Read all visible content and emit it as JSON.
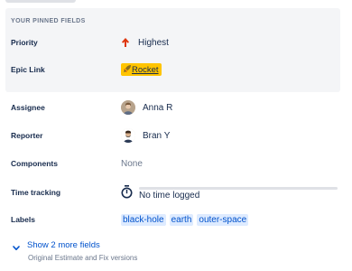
{
  "pinned": {
    "heading": "YOUR PINNED FIELDS",
    "fields": [
      {
        "label": "Priority",
        "value": "Highest",
        "icon": "arrow-up-icon",
        "icon_color": "#de350b"
      },
      {
        "label": "Epic Link",
        "value": "Rocket",
        "icon": "rocket-icon",
        "lozenge_color": "#ffc400"
      }
    ]
  },
  "fields": {
    "assignee": {
      "label": "Assignee",
      "value": "Anna R"
    },
    "reporter": {
      "label": "Reporter",
      "value": "Bran Y"
    },
    "components": {
      "label": "Components",
      "value": "None"
    },
    "time_tracking": {
      "label": "Time tracking",
      "value": "No time logged",
      "progress": 0
    },
    "labels": {
      "label": "Labels",
      "tags": [
        "black-hole",
        "earth",
        "outer-space"
      ]
    }
  },
  "more": {
    "toggle_label": "Show 2 more fields",
    "subtext": "Original Estimate and Fix versions"
  },
  "colors": {
    "pinned_bg": "#f4f5f7",
    "link": "#0052cc",
    "label_tag_bg": "#deebff",
    "muted": "#6b778c"
  }
}
